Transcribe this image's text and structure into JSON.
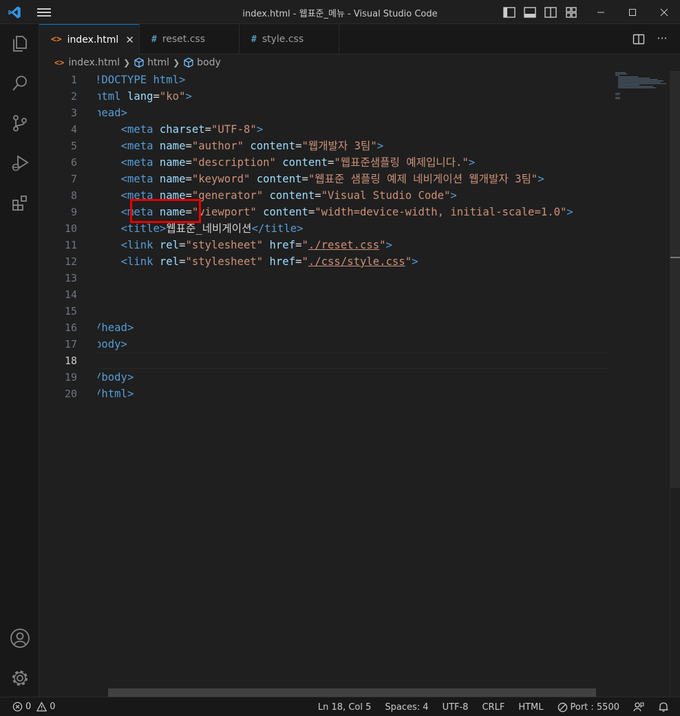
{
  "window": {
    "title": "index.html - 웹표준_메뉴 - Visual Studio Code",
    "accent": "#0078d4"
  },
  "activity_bar": {
    "items": [
      {
        "name": "explorer",
        "icon": "files-icon"
      },
      {
        "name": "search",
        "icon": "search-icon"
      },
      {
        "name": "source-control",
        "icon": "source-control-icon"
      },
      {
        "name": "run-debug",
        "icon": "run-debug-icon"
      },
      {
        "name": "extensions",
        "icon": "extensions-icon"
      }
    ],
    "bottom": [
      {
        "name": "accounts",
        "icon": "account-icon"
      },
      {
        "name": "manage",
        "icon": "gear-icon"
      }
    ]
  },
  "tabs": [
    {
      "label": "index.html",
      "icon": "<>",
      "active": true
    },
    {
      "label": "reset.css",
      "icon": "#",
      "active": false
    },
    {
      "label": "style.css",
      "icon": "#",
      "active": false
    }
  ],
  "breadcrumb": [
    "index.html",
    "html",
    "body"
  ],
  "editor": {
    "current_line": 18,
    "line_numbers": [
      "1",
      "2",
      "3",
      "4",
      "5",
      "6",
      "7",
      "8",
      "9",
      "10",
      "11",
      "12",
      "13",
      "14",
      "15",
      "16",
      "17",
      "18",
      "19",
      "20"
    ],
    "lines": [
      [
        {
          "t": "tag",
          "v": "!DOCTYPE html>"
        }
      ],
      [
        {
          "t": "tag",
          "v": "html "
        },
        {
          "t": "attr",
          "v": "lang"
        },
        {
          "t": "txt",
          "v": "="
        },
        {
          "t": "str",
          "v": "\"ko\""
        },
        {
          "t": "tag",
          "v": ">"
        }
      ],
      [
        {
          "t": "tag",
          "v": "head>"
        }
      ],
      [
        {
          "t": "txt",
          "v": "    "
        },
        {
          "t": "tag",
          "v": "<meta "
        },
        {
          "t": "attr",
          "v": "charset"
        },
        {
          "t": "txt",
          "v": "="
        },
        {
          "t": "str",
          "v": "\"UTF-8\""
        },
        {
          "t": "tag",
          "v": ">"
        }
      ],
      [
        {
          "t": "txt",
          "v": "    "
        },
        {
          "t": "tag",
          "v": "<meta "
        },
        {
          "t": "attr",
          "v": "name"
        },
        {
          "t": "txt",
          "v": "="
        },
        {
          "t": "str",
          "v": "\"author\" "
        },
        {
          "t": "attr",
          "v": "content"
        },
        {
          "t": "txt",
          "v": "="
        },
        {
          "t": "str",
          "v": "\"웹개발자 3팀\""
        },
        {
          "t": "tag",
          "v": ">"
        }
      ],
      [
        {
          "t": "txt",
          "v": "    "
        },
        {
          "t": "tag",
          "v": "<meta "
        },
        {
          "t": "attr",
          "v": "name"
        },
        {
          "t": "txt",
          "v": "="
        },
        {
          "t": "str",
          "v": "\"description\" "
        },
        {
          "t": "attr",
          "v": "content"
        },
        {
          "t": "txt",
          "v": "="
        },
        {
          "t": "str",
          "v": "\"웹표준샘플링 예제입니다.\""
        },
        {
          "t": "tag",
          "v": ">"
        }
      ],
      [
        {
          "t": "txt",
          "v": "    "
        },
        {
          "t": "tag",
          "v": "<meta "
        },
        {
          "t": "attr",
          "v": "name"
        },
        {
          "t": "txt",
          "v": "="
        },
        {
          "t": "str",
          "v": "\"keyword\" "
        },
        {
          "t": "attr",
          "v": "content"
        },
        {
          "t": "txt",
          "v": "="
        },
        {
          "t": "str",
          "v": "\"웹표준 샘플링 예제 네비게이션 웹개발자 3팀\""
        },
        {
          "t": "tag",
          "v": ">"
        }
      ],
      [
        {
          "t": "txt",
          "v": "    "
        },
        {
          "t": "tag",
          "v": "<meta "
        },
        {
          "t": "attr",
          "v": "name"
        },
        {
          "t": "txt",
          "v": "="
        },
        {
          "t": "str",
          "v": "\"generator\" "
        },
        {
          "t": "attr",
          "v": "content"
        },
        {
          "t": "txt",
          "v": "="
        },
        {
          "t": "str",
          "v": "\"Visual Studio Code\""
        },
        {
          "t": "tag",
          "v": ">"
        }
      ],
      [
        {
          "t": "txt",
          "v": "    "
        },
        {
          "t": "tag",
          "v": "<meta "
        },
        {
          "t": "attr",
          "v": "name"
        },
        {
          "t": "txt",
          "v": "="
        },
        {
          "t": "str",
          "v": "\"viewport\" "
        },
        {
          "t": "attr",
          "v": "content"
        },
        {
          "t": "txt",
          "v": "="
        },
        {
          "t": "str",
          "v": "\"width=device-width, initial-scale=1.0\""
        },
        {
          "t": "tag",
          "v": ">"
        }
      ],
      [
        {
          "t": "txt",
          "v": "    "
        },
        {
          "t": "tag",
          "v": "<title>"
        },
        {
          "t": "txt",
          "v": "웹표준_네비게이션"
        },
        {
          "t": "tag",
          "v": "</title>"
        }
      ],
      [
        {
          "t": "txt",
          "v": "    "
        },
        {
          "t": "tag",
          "v": "<link "
        },
        {
          "t": "attr",
          "v": "rel"
        },
        {
          "t": "txt",
          "v": "="
        },
        {
          "t": "str",
          "v": "\"stylesheet\" "
        },
        {
          "t": "attr",
          "v": "href"
        },
        {
          "t": "txt",
          "v": "="
        },
        {
          "t": "str",
          "v": "\""
        },
        {
          "t": "strul",
          "v": "./reset.css"
        },
        {
          "t": "str",
          "v": "\""
        },
        {
          "t": "tag",
          "v": ">"
        }
      ],
      [
        {
          "t": "txt",
          "v": "    "
        },
        {
          "t": "tag",
          "v": "<link "
        },
        {
          "t": "attr",
          "v": "rel"
        },
        {
          "t": "txt",
          "v": "="
        },
        {
          "t": "str",
          "v": "\"stylesheet\" "
        },
        {
          "t": "attr",
          "v": "href"
        },
        {
          "t": "txt",
          "v": "="
        },
        {
          "t": "str",
          "v": "\""
        },
        {
          "t": "strul",
          "v": "./css/style.css"
        },
        {
          "t": "str",
          "v": "\""
        },
        {
          "t": "tag",
          "v": ">"
        }
      ],
      [],
      [],
      [],
      [
        {
          "t": "tag",
          "v": "/head>"
        }
      ],
      [
        {
          "t": "tag",
          "v": "body>"
        }
      ],
      [],
      [
        {
          "t": "tag",
          "v": "/body>"
        }
      ],
      [
        {
          "t": "tag",
          "v": "/html>"
        }
      ]
    ]
  },
  "status_bar": {
    "errors": "0",
    "warnings": "0",
    "position": "Ln 18, Col 5",
    "spaces": "Spaces: 4",
    "encoding": "UTF-8",
    "eol": "CRLF",
    "language": "HTML",
    "port": "Port : 5500"
  }
}
